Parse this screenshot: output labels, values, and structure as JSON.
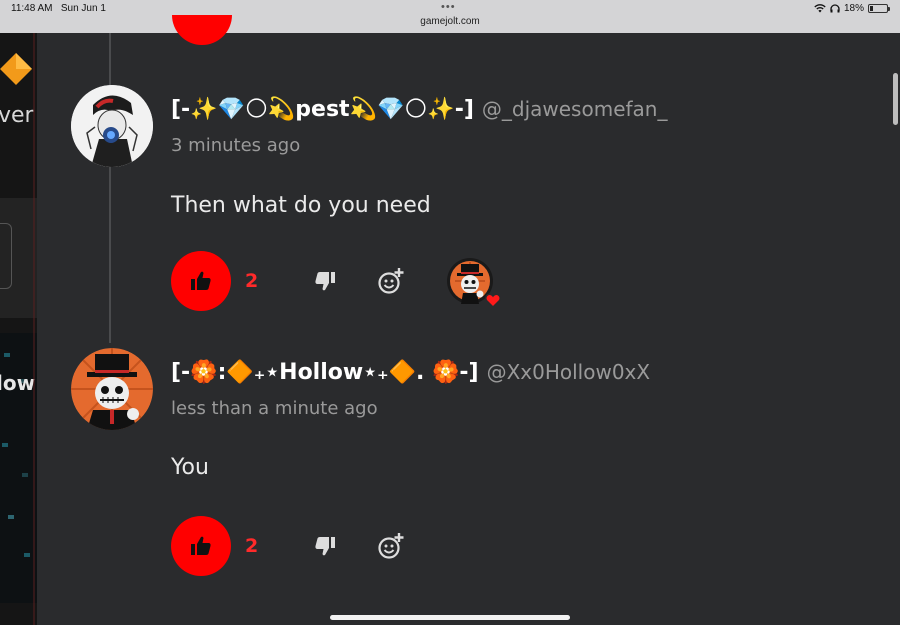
{
  "status_bar": {
    "time": "11:48 AM",
    "date": "Sun Jun 1",
    "more": "•••",
    "url": "gamejolt.com",
    "battery": "18%",
    "battery_level": 0.18
  },
  "background_page": {
    "text_top": "ver",
    "text_bottom": "low"
  },
  "comments": [
    {
      "display_name": "[-✨💎🌕💫pest💫💎🌕✨-]",
      "username": "@_djawesomefan_",
      "time": "3 minutes ago",
      "text": "Then what do you need",
      "likes": "2",
      "has_liked_by_avatar": true
    },
    {
      "display_name": "[-🏵️꞉🔶₊⋆Hollow⋆₊🔶. 🏵️-]",
      "username": "@Xx0Hollow0xX",
      "time": "less than a minute ago",
      "text": "You",
      "likes": "2",
      "has_liked_by_avatar": false
    }
  ],
  "colors": {
    "like": "#ff0000",
    "background": "#2a2b2d",
    "muted": "#9a9a9a"
  },
  "icons": {
    "like": "thumbs-up-icon",
    "dislike": "thumbs-down-icon",
    "react": "add-emoji-icon",
    "liked_by": "heart-icon"
  }
}
